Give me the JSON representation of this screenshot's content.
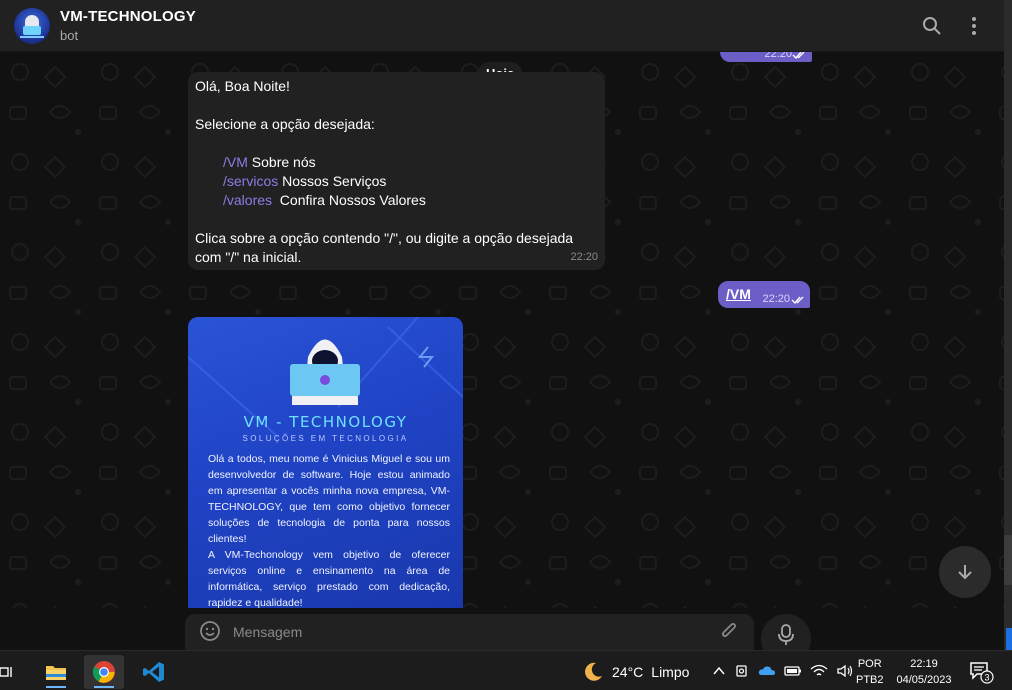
{
  "header": {
    "title": "VM-TECHNOLOGY",
    "subtitle": "bot",
    "search_icon": "search-icon",
    "menu_icon": "more-vertical-icon"
  },
  "chat": {
    "date_label": "Hoje",
    "top_message": {
      "text": "",
      "time": "22:20"
    },
    "welcome": {
      "line1": "Olá, Boa Noite!",
      "line2": "Selecione a opção desejada:",
      "options": [
        {
          "command": "/VM",
          "text": " Sobre nós"
        },
        {
          "command": "/servicos",
          "text": " Nossos Serviços"
        },
        {
          "command": "/valores",
          "text": "  Confira Nossos Valores"
        }
      ],
      "line3": "Clica sobre a opção contendo \"/\", ou digite a opção desejada com \"/\" na inicial.",
      "time": "22:20"
    },
    "vm_message": {
      "text": "/VM",
      "time": "22:20"
    },
    "media": {
      "brand": "VM - TECHNOLOGY",
      "tagline": "SOLUÇÕES EM TECNOLOGIA",
      "paragraph1": "Olá a todos, meu nome é Vinicius Miguel e sou um desenvolvedor de software. Hoje estou animado em apresentar a vocês minha nova empresa, VM-TECHNOLOGY, que tem como objetivo fornecer soluções de tecnologia de ponta para nossos clientes!",
      "paragraph2": "A VM-Techonology  vem objetivo de oferecer serviços online e ensinamento na área de informática, serviço prestado com dedicação, rapidez e qualidade!"
    }
  },
  "composer": {
    "placeholder": "Mensagem"
  },
  "taskbar": {
    "weather_temp": "24°C",
    "weather_text": "Limpo",
    "lang_line1": "POR",
    "lang_line2": "PTB2",
    "time": "22:19",
    "date": "04/05/2023",
    "notification_count": "3"
  },
  "colors": {
    "outgoing_bubble": "#6b5fc7",
    "incoming_bubble": "#212121",
    "command_link": "#8e7ce6",
    "media_background": "#2249cf"
  }
}
